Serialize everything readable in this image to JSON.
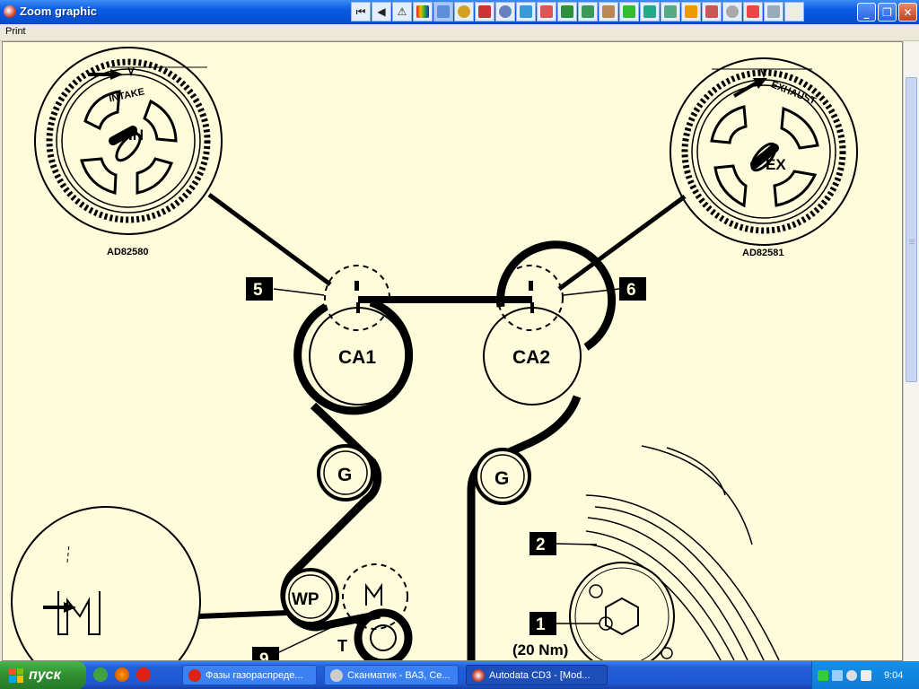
{
  "window": {
    "title": "Zoom graphic"
  },
  "toolbar": {
    "icons": [
      "first-page-icon",
      "previous-page-icon",
      "warning-icon",
      "color-palette-icon",
      "diagram-icon",
      "gear-icon",
      "wrench-icon",
      "disc-icon",
      "chart-icon",
      "car-icon",
      "battery-icon",
      "engine-icon",
      "tools-icon",
      "book-icon",
      "brake-icon",
      "paint-icon",
      "settings-icon",
      "wheel-icon",
      "ac-icon",
      "lubricant-icon",
      "notes-icon"
    ]
  },
  "menu": {
    "print": "Print"
  },
  "diagram": {
    "intake_label": "INTAKE",
    "in_label": "IN",
    "intake_code": "AD82580",
    "exhaust_label": "EXHAUST",
    "ex_label": "EX",
    "exhaust_code": "AD82581",
    "callout_5": "5",
    "callout_6": "6",
    "ca1": "CA1",
    "ca2": "CA2",
    "g_left": "G",
    "g_right": "G",
    "wp": "WP",
    "t": "T",
    "callout_2": "2",
    "callout_1": "1",
    "callout_9": "9",
    "torque": "(20 Nm)"
  },
  "taskbar": {
    "start_label": "пуск",
    "tasks": [
      {
        "label": "Фазы газораспреде..."
      },
      {
        "label": "Сканматик - ВАЗ, Се..."
      },
      {
        "label": "Autodata CD3 - [Mod..."
      }
    ],
    "clock": "9:04"
  },
  "colors": {
    "canvas_bg": "#fffcdc",
    "titlebar": "#0a5ce3",
    "taskbar": "#245edb",
    "start": "#2f8f2f",
    "ink": "#000000"
  }
}
